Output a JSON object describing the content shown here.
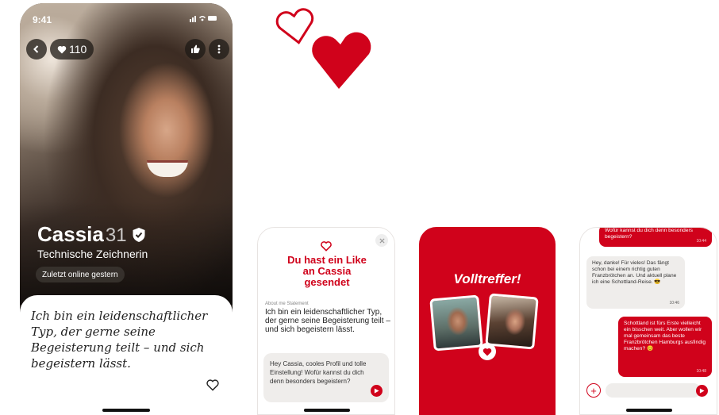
{
  "colors": {
    "accent": "#d0021b",
    "bubble_grey": "#efedeb"
  },
  "phone1": {
    "status_time": "9:41",
    "status_icons": "signal-wifi-battery",
    "likes_count": "110",
    "name": "Cassia",
    "age": "31",
    "job": "Technische Zeichnerin",
    "online_status": "Zuletzt online gestern",
    "quote": "Ich bin ein leidenschaftlicher Typ, der gerne seine Begeisterung teilt – und sich begeistern lässt."
  },
  "phone2": {
    "title": "Du hast ein Like an Cassia gesendet",
    "statement_label": "About me Statement",
    "statement": "Ich bin ein leidenschaftlicher Typ, der gerne seine Begeisterung teilt – und sich begeistern lässt.",
    "message": "Hey Cassia, cooles Profil und tolle Einstellung! Wofür kannst du dich denn besonders begeistern?"
  },
  "phone3": {
    "headline": "Volltreffer!"
  },
  "phone4": {
    "msg1_text": "Wofür kannst du dich denn besonders begeistern?",
    "msg1_time": "10:44",
    "msg2_text": "Hey, danke! Für vieles! Das fängt schon bei einem richtig guten Franzbrötchen an. Und aktuell plane ich eine Schottland-Reise. 😎",
    "msg2_time": "10:46",
    "msg3_text": "Schottland ist fürs Erste vielleicht ein bisschen weit. Aber wollen wir mal gemeinsam das beste Franzbrötchen Hamburgs ausfindig machen? 😊",
    "msg3_time": "10:48"
  }
}
